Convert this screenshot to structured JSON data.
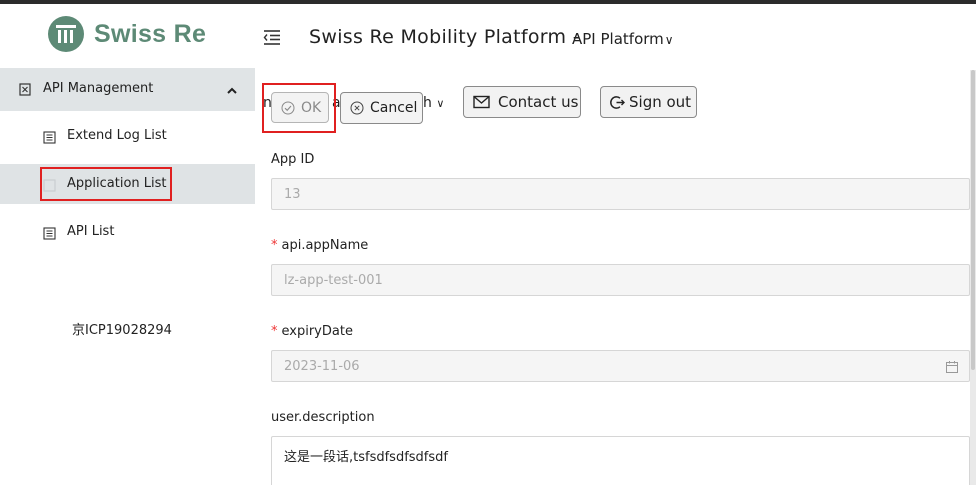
{
  "header": {
    "logo_text": "Swiss Re",
    "app_title": "Swiss Re Mobility Platform  -",
    "platform_select": "API Platform"
  },
  "sidebar": {
    "group_label": "API Management",
    "items": [
      {
        "label": "Extend Log List"
      },
      {
        "label": "Application List"
      },
      {
        "label": "API List"
      }
    ],
    "icp": "京ICP19028294"
  },
  "toolbar": {
    "behind_left": "n",
    "behind_mid": "a",
    "behind_right": "h",
    "ok_label": "OK",
    "cancel_label": "Cancel",
    "contact_label": "Contact us",
    "signout_label": "Sign out"
  },
  "form": {
    "app_id_label": "App ID",
    "app_id_value": "13",
    "app_name_label": "api.appName",
    "app_name_value": "lz-app-test-001",
    "expiry_label": "expiryDate",
    "expiry_value": "2023-11-06",
    "description_label": "user.description",
    "description_value": "这是一段话,tsfsdfsdfsdfsdf"
  },
  "colors": {
    "brand": "#5d8a76",
    "highlight": "#e02020",
    "required": "#e33333",
    "sidebar_active": "#dfe3e5"
  },
  "icons": [
    "hamburger-indent-icon",
    "api-management-icon",
    "chevron-up-icon",
    "list-icon",
    "check-circle-icon",
    "close-circle-icon",
    "mail-icon",
    "logout-icon",
    "calendar-icon"
  ]
}
